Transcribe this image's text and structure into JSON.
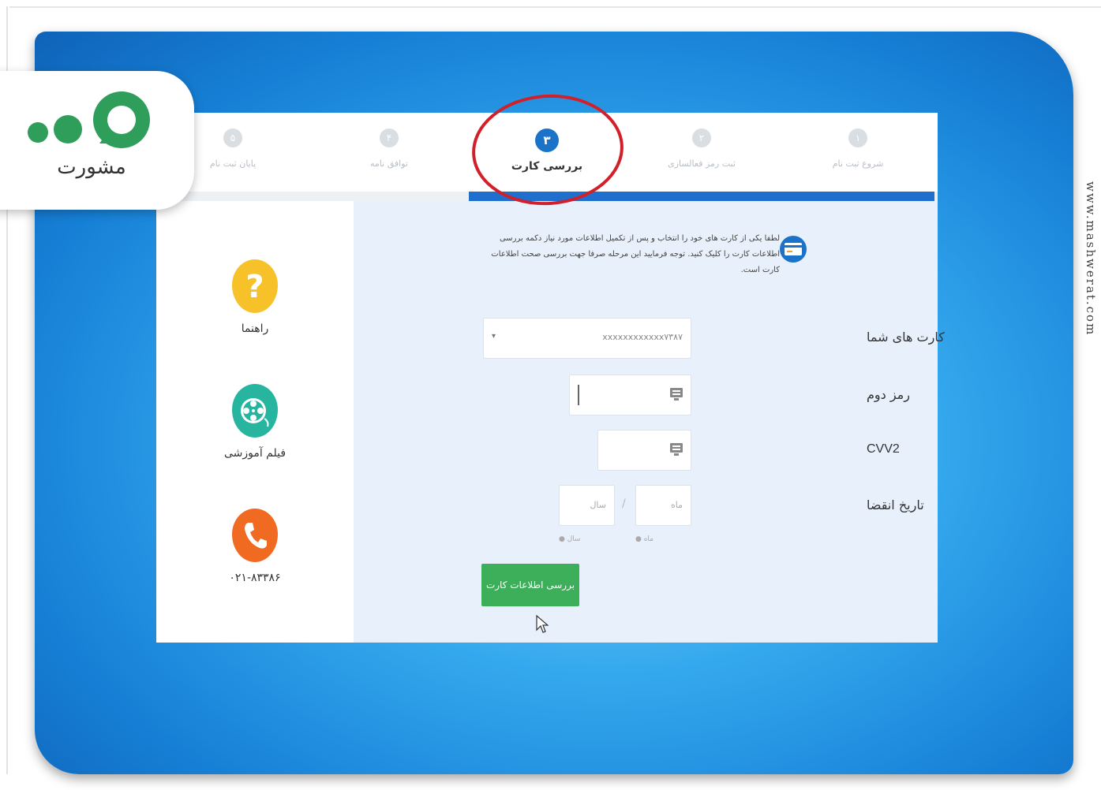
{
  "brand": {
    "logo_text": "مشورت",
    "website": "www.mashwerat.com"
  },
  "steps": [
    {
      "number": "۱",
      "label": "شروع ثبت نام"
    },
    {
      "number": "۲",
      "label": "ثبت رمز فعالسازی"
    },
    {
      "number": "۳",
      "label": "بررسی کارت"
    },
    {
      "number": "۴",
      "label": "توافق نامه"
    },
    {
      "number": "۵",
      "label": "پایان ثبت نام"
    }
  ],
  "sidebar": {
    "help": {
      "label": "راهنما",
      "icon": "question-icon",
      "color": "#f7c12a"
    },
    "video": {
      "label": "فیلم آموزشی",
      "icon": "film-reel-icon",
      "color": "#27b5a0"
    },
    "phone": {
      "label": "۰۲۱-۸۳۳۸۶",
      "icon": "phone-icon",
      "color": "#f06a22"
    }
  },
  "info_text": "لطفا یکی از کارت های خود را انتخاب و پس از تکمیل اطلاعات مورد نیاز دکمه بررسی اطلاعات کارت را کلیک کنید. توجه فرمایید این مرحله صرفا جهت بررسی صحت اطلاعات کارت است.",
  "form": {
    "cards_label": "کارت های شما",
    "card_value": "xxxxxxxxxxxx۷۳۸۷",
    "pin2_label": "رمز دوم",
    "cvv2_label": "CVV2",
    "expiry_label": "تاریخ انقضا",
    "month_placeholder": "ماه",
    "year_placeholder": "سال",
    "separator": "/",
    "month_hint": "ماه",
    "year_hint": "سال",
    "submit_label": "بررسی اطلاعات کارت"
  },
  "colors": {
    "primary": "#1a73c9",
    "submit": "#3dae5a",
    "highlight": "#d1202a"
  }
}
